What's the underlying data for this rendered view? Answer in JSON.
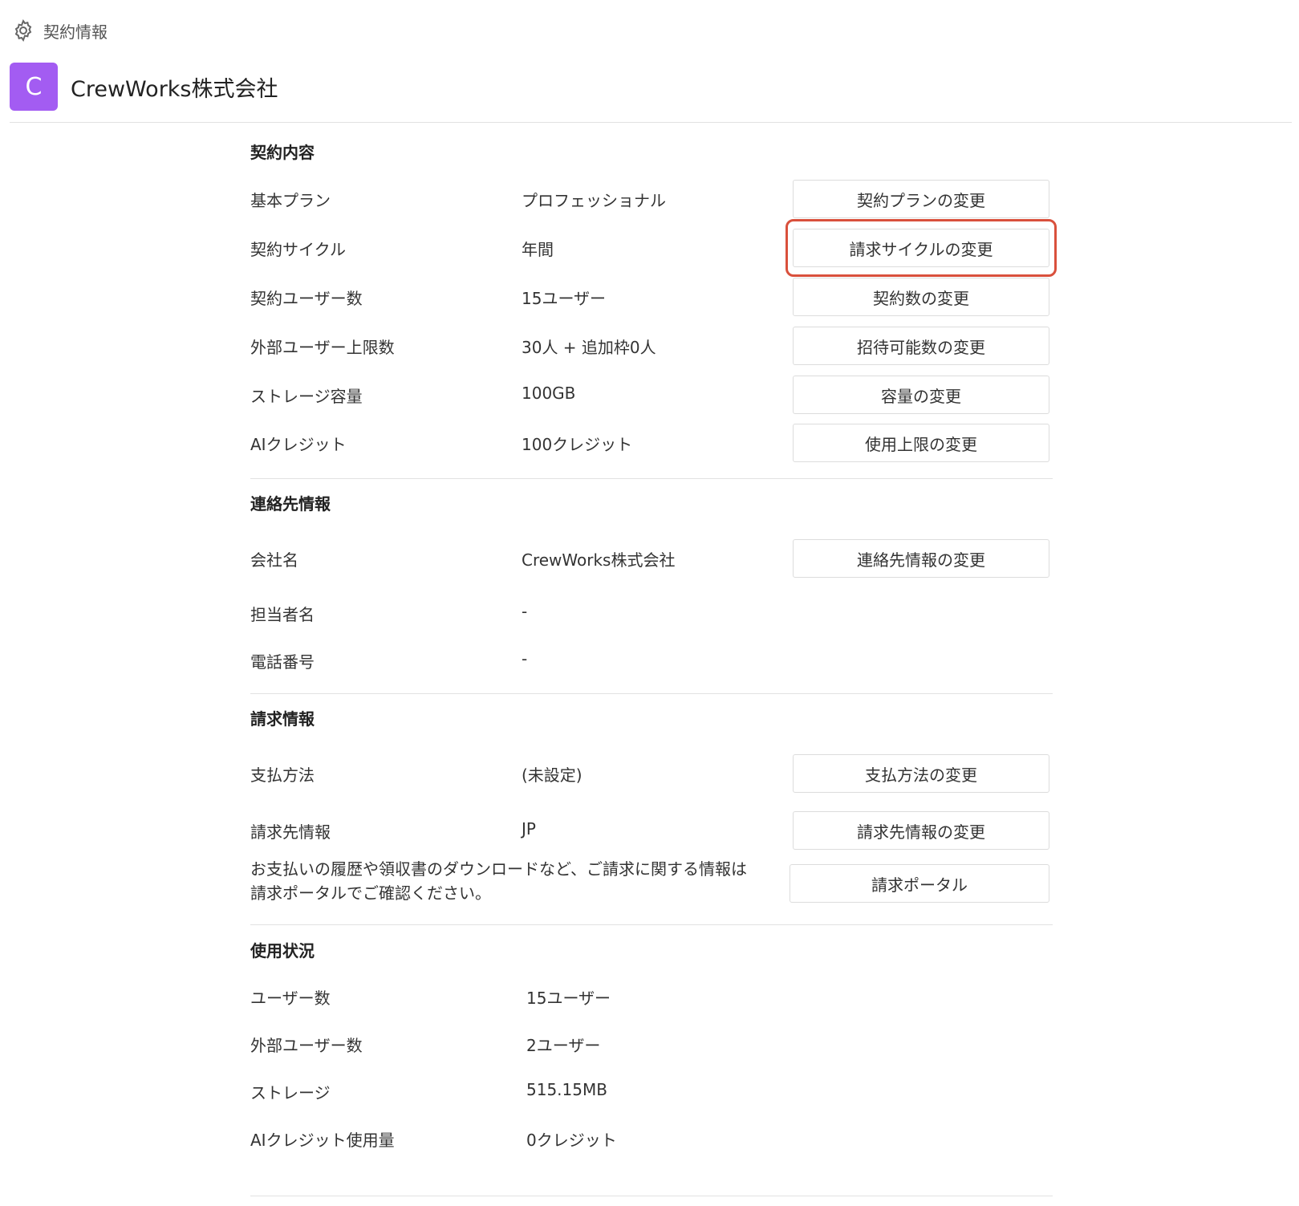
{
  "header": {
    "section_label": "契約情報",
    "avatar_letter": "C",
    "company_name": "CrewWorks株式会社"
  },
  "contract": {
    "title": "契約内容",
    "rows": [
      {
        "label": "基本プラン",
        "value": "プロフェッショナル",
        "button": "契約プランの変更"
      },
      {
        "label": "契約サイクル",
        "value": "年間",
        "button": "請求サイクルの変更",
        "highlighted": true
      },
      {
        "label": "契約ユーザー数",
        "value": "15ユーザー",
        "button": "契約数の変更"
      },
      {
        "label": "外部ユーザー上限数",
        "value": "30人 + 追加枠0人",
        "button": "招待可能数の変更"
      },
      {
        "label": "ストレージ容量",
        "value": "100GB",
        "button": "容量の変更"
      },
      {
        "label": "AIクレジット",
        "value": "100クレジット",
        "button": "使用上限の変更"
      }
    ]
  },
  "contact": {
    "title": "連絡先情報",
    "rows": [
      {
        "label": "会社名",
        "value": "CrewWorks株式会社",
        "button": "連絡先情報の変更"
      },
      {
        "label": "担当者名",
        "value": "-"
      },
      {
        "label": "電話番号",
        "value": "-"
      }
    ]
  },
  "billing": {
    "title": "請求情報",
    "rows": [
      {
        "label": "支払方法",
        "value": "(未設定)",
        "button": "支払方法の変更"
      },
      {
        "label": "請求先情報",
        "value": "JP",
        "button": "請求先情報の変更"
      }
    ],
    "portal_note_line1": "お支払いの履歴や領収書のダウンロードなど、ご請求に関する情報は",
    "portal_note_line2": "請求ポータルでご確認ください。",
    "portal_button": "請求ポータル"
  },
  "usage": {
    "title": "使用状況",
    "rows": [
      {
        "label": "ユーザー数",
        "value": "15ユーザー"
      },
      {
        "label": "外部ユーザー数",
        "value": "2ユーザー"
      },
      {
        "label": "ストレージ",
        "value": "515.15MB"
      },
      {
        "label": "AIクレジット使用量",
        "value": "0クレジット"
      }
    ]
  },
  "colors": {
    "avatar": "#a35cf2",
    "highlight": "#d9503c"
  }
}
